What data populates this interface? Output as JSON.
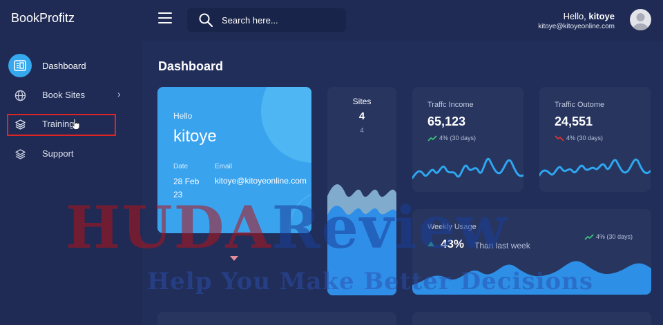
{
  "app": {
    "brand": "BookProfitz"
  },
  "header": {
    "search_placeholder": "Search here...",
    "greeting_prefix": "Hello, ",
    "user_name": "kitoye",
    "user_email": "kitoye@kitoyeonline.com"
  },
  "sidebar": {
    "items": [
      {
        "label": "Dashboard",
        "icon": "dashboard-icon",
        "active": true
      },
      {
        "label": "Book Sites",
        "icon": "globe-icon",
        "has_submenu": true
      },
      {
        "label": "Training",
        "icon": "layers-icon"
      },
      {
        "label": "Support",
        "icon": "layers-icon"
      }
    ]
  },
  "main": {
    "title": "Dashboard",
    "welcome": {
      "hello": "Hello",
      "name": "kitoye",
      "date_label": "Date",
      "date_value": "28 Feb 23",
      "email_label": "Email",
      "email_value": "kitoye@kitoyeonline.com"
    },
    "sites": {
      "title": "Sites",
      "value": "4",
      "sub": "4"
    },
    "traffic_income": {
      "title": "Traffc Income",
      "value": "65,123",
      "change": "4% (30 days)",
      "trend": "up"
    },
    "traffic_outcome": {
      "title": "Traffic Outome",
      "value": "24,551",
      "change": "4% (30 days)",
      "trend": "down"
    },
    "weekly": {
      "title": "Weekly Usage",
      "value": "43%",
      "sub": "Than last week",
      "change": "4% (30 days)"
    }
  },
  "watermark": {
    "line1_part1": "HUDA",
    "line1_part2": "Review",
    "line2": "Help You Make Better Decisions"
  },
  "colors": {
    "accent": "#35a8ee",
    "up": "#3ec57a",
    "down": "#e0342e",
    "highlight": "#e02424"
  }
}
